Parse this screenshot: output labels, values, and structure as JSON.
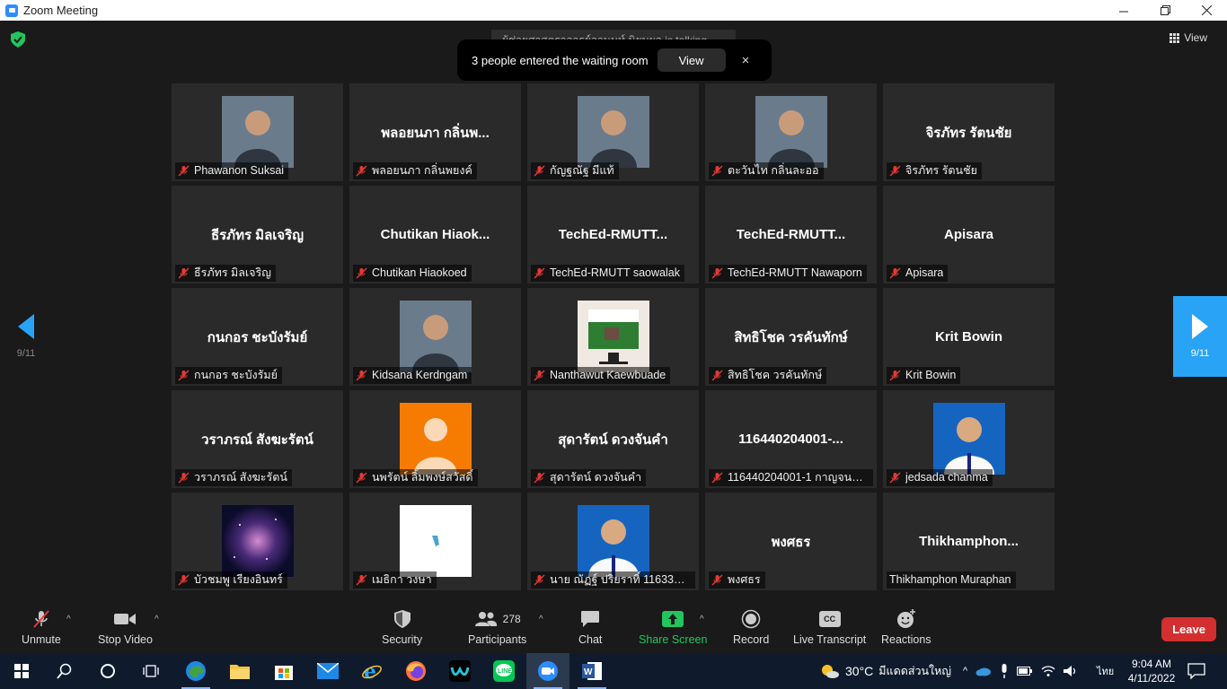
{
  "window": {
    "title": "Zoom Meeting"
  },
  "header": {
    "view_label": "View",
    "talking": "ผู้ช่วยศาสตราจารย์อานนท์ นิยมผล is talking...",
    "toast": {
      "text": "3 people entered the waiting room",
      "view_label": "View",
      "close": "×"
    }
  },
  "tiles": [
    {
      "name": "Phawanon Suksai",
      "big": "",
      "photo": "person"
    },
    {
      "name": "พลอยนภา กลิ่นพยงค์",
      "big": "พลอยนภา กลิ่นพ...",
      "photo": ""
    },
    {
      "name": "กัญฐณัฐ มีแท้",
      "big": "",
      "photo": "person"
    },
    {
      "name": "ตะวันไท กลิ่นละออ",
      "big": "",
      "photo": "person"
    },
    {
      "name": "จิรภัทร รัตนชัย",
      "big": "จิรภัทร รัตนชัย",
      "photo": ""
    },
    {
      "name": "ธีรภัทร มิลเจริญ",
      "big": "ธีรภัทร มิลเจริญ",
      "photo": ""
    },
    {
      "name": "Chutikan Hiaokoed",
      "big": "Chutikan  Hiaok...",
      "photo": ""
    },
    {
      "name": "TechEd-RMUTT saowalak",
      "big": "TechEd-RMUTT...",
      "photo": ""
    },
    {
      "name": "TechEd-RMUTT Nawaporn",
      "big": "TechEd-RMUTT...",
      "photo": ""
    },
    {
      "name": "Apisara",
      "big": "Apisara",
      "photo": ""
    },
    {
      "name": "กนกอร ชะบังรัมย์",
      "big": "กนกอร ชะบังรัมย์",
      "photo": ""
    },
    {
      "name": "Kidsana Kerdngam",
      "big": "",
      "photo": "person"
    },
    {
      "name": "Nanthawut Kaewbuade",
      "big": "",
      "photo": "picture"
    },
    {
      "name": "สิทธิโชค วรคันทักษ์",
      "big": "สิทธิโชค วรคันทักษ์",
      "photo": ""
    },
    {
      "name": "Krit Bowin",
      "big": "Krit Bowin",
      "photo": ""
    },
    {
      "name": "วราภรณ์ สังฆะรัตน์",
      "big": "วราภรณ์ สังฆะรัตน์",
      "photo": ""
    },
    {
      "name": "นพรัตน์ ลิ้มพงษ์สวัสดิ์",
      "big": "",
      "photo": "avatar"
    },
    {
      "name": "สุดารัตน์ ดวงจันคำ",
      "big": "สุดารัตน์ ดวงจันคำ",
      "photo": ""
    },
    {
      "name": "116440204001-1 กาญจนา ผ...",
      "big": "116440204001-...",
      "photo": ""
    },
    {
      "name": "jedsada chanma",
      "big": "",
      "photo": "portrait"
    },
    {
      "name": "บัวชมพู เรียงอินทร์",
      "big": "",
      "photo": "galaxy"
    },
    {
      "name": "เมธิกา วงษา",
      "big": "",
      "photo": "white"
    },
    {
      "name": "นาย ณัฏฐ์ ปริยราทิ์ 11633020...",
      "big": "",
      "photo": "portrait"
    },
    {
      "name": "พงศธร",
      "big": "พงศธร",
      "photo": ""
    },
    {
      "name": "Thikhamphon Muraphan",
      "big": "Thikhamphon...",
      "photo": "",
      "nomic": true
    }
  ],
  "pagination": {
    "left": "9/11",
    "right": "9/11"
  },
  "toolbar": {
    "unmute": "Unmute",
    "stop_video": "Stop Video",
    "security": "Security",
    "participants": "Participants",
    "participants_count": "278",
    "chat": "Chat",
    "share_screen": "Share Screen",
    "record": "Record",
    "live_transcript": "Live Transcript",
    "cc": "CC",
    "reactions": "Reactions",
    "leave": "Leave"
  },
  "taskbar": {
    "weather_temp": "30°C",
    "weather_text": "มีแดดส่วนใหญ่",
    "lang": "ไทย",
    "time": "9:04 AM",
    "date": "4/11/2022"
  },
  "colors": {
    "accent": "#29a3f5",
    "leave": "#d32f2f",
    "share": "#22c55e",
    "tile": "#2a2a2a"
  }
}
